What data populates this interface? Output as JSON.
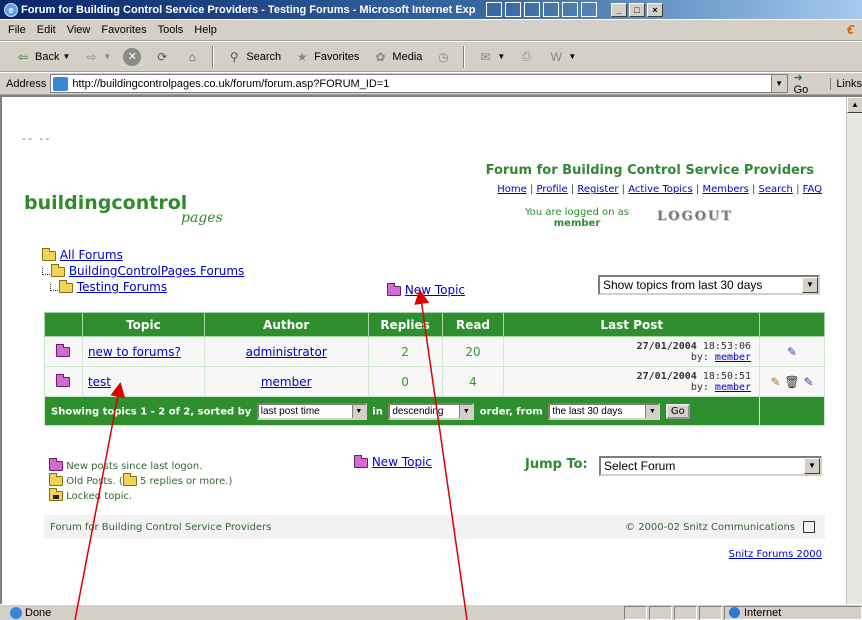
{
  "window": {
    "title": "Forum for Building Control Service Providers - Testing Forums - Microsoft Internet Explorer provide",
    "controls": [
      "_",
      "□",
      "×"
    ]
  },
  "menu": {
    "items": [
      "File",
      "Edit",
      "View",
      "Favorites",
      "Tools",
      "Help"
    ]
  },
  "toolbar": {
    "back_label": "Back",
    "search_label": "Search",
    "favorites_label": "Favorites",
    "media_label": "Media"
  },
  "address": {
    "label": "Address",
    "url": "http://buildingcontrolpages.co.uk/forum/forum.asp?FORUM_ID=1",
    "go_label": "Go",
    "links_label": "Links"
  },
  "page": {
    "dashes": "-- --",
    "logo_main": "buildingcontrol",
    "logo_sub": "pages",
    "forum_title": "Forum for Building Control Service Providers",
    "nav_links": [
      "Home",
      "Profile",
      "Register",
      "Active Topics",
      "Members",
      "Search",
      "FAQ"
    ],
    "logged_on_text": "You are logged on as",
    "logged_on_user": "member",
    "logout_label": "LOGOUT",
    "breadcrumb": [
      "All Forums",
      "BuildingControlPages Forums",
      "Testing Forums"
    ],
    "new_topic_label": "New Topic",
    "show_topics_value": "Show topics from last 30 days",
    "table": {
      "headers": [
        "Topic",
        "Author",
        "Replies",
        "Read",
        "Last Post"
      ],
      "rows": [
        {
          "topic": "new to forums?",
          "author": "administrator",
          "replies": "2",
          "read": "20",
          "last_date": "27/01/2004",
          "last_time": "18:53:06",
          "by": "by:",
          "last_by": "member"
        },
        {
          "topic": "test",
          "author": "member",
          "replies": "0",
          "read": "4",
          "last_date": "27/01/2004",
          "last_time": "18:50:51",
          "by": "by:",
          "last_by": "member"
        }
      ],
      "footer": {
        "showing": "Showing topics 1 - 2 of 2, sorted by",
        "sort_value": "last post time",
        "in_label": "in",
        "order_value": "descending",
        "from_label": "order, from",
        "period_value": "the last 30 days",
        "go_label": "Go"
      }
    },
    "legend": {
      "new_posts": "New posts since last logon.",
      "old_posts": "Old Posts. (",
      "hot": "5 replies or more.)",
      "locked": "Locked topic."
    },
    "jump_label": "Jump To:",
    "jump_value": "Select Forum",
    "footer_left": "Forum for Building Control Service Providers",
    "footer_copyright": "© 2000-02 Snitz Communications",
    "snitz_link": "Snitz Forums 2000"
  },
  "status": {
    "text": "Done",
    "zone": "Internet"
  },
  "colors": {
    "forum_green": "#2f8f2f",
    "link_blue": "#0000cc",
    "annotation_red": "#dd0000"
  }
}
